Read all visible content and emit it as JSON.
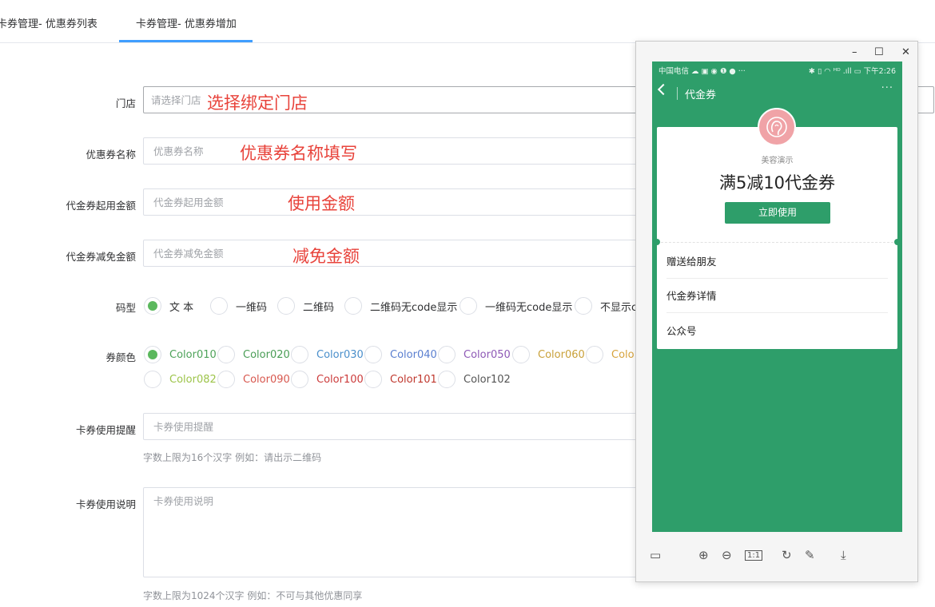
{
  "tabs": [
    {
      "label": "卡券管理- 优惠券列表",
      "active": false
    },
    {
      "label": "卡券管理- 优惠券增加",
      "active": true
    }
  ],
  "accent_color": "#409eff",
  "form": {
    "store": {
      "label": "门店",
      "placeholder": "请选择门店",
      "annotation": "选择绑定门店"
    },
    "coupon_name": {
      "label": "优惠券名称",
      "placeholder": "优惠券名称",
      "annotation": "优惠券名称填写"
    },
    "min_amount": {
      "label": "代金券起用金额",
      "placeholder": "代金券起用金额",
      "annotation": "使用金额"
    },
    "reduce_amount": {
      "label": "代金券减免金额",
      "placeholder": "代金券减免金额",
      "annotation": "减免金额"
    },
    "code_type": {
      "label": "码型",
      "options": [
        "文 本",
        "一维码",
        "二维码",
        "二维码无code显示",
        "一维码无code显示",
        "不显示c"
      ],
      "selected": 0
    },
    "color": {
      "label": "券颜色",
      "options": [
        {
          "name": "Color010",
          "hex": "#4ea35a"
        },
        {
          "name": "Color020",
          "hex": "#4a9d56"
        },
        {
          "name": "Color030",
          "hex": "#4a8fcb"
        },
        {
          "name": "Color040",
          "hex": "#5a7fd0"
        },
        {
          "name": "Color050",
          "hex": "#8e59b6"
        },
        {
          "name": "Color060",
          "hex": "#c9a13a"
        },
        {
          "name": "Colo",
          "hex": "#d7a33b"
        },
        {
          "name": "Color082",
          "hex": "#9dc44a"
        },
        {
          "name": "Color090",
          "hex": "#d8584f"
        },
        {
          "name": "Color100",
          "hex": "#cc3c3c"
        },
        {
          "name": "Color101",
          "hex": "#c0392f"
        },
        {
          "name": "Color102",
          "hex": "#555555"
        }
      ],
      "selected": 0
    },
    "reminder": {
      "label": "卡券使用提醒",
      "placeholder": "卡券使用提醒",
      "hint": "字数上限为16个汉字 例如：请出示二维码"
    },
    "description": {
      "label": "卡券使用说明",
      "placeholder": "卡券使用说明",
      "hint": "字数上限为1024个汉字 例如：不可与其他优惠同享"
    }
  },
  "preview": {
    "window_buttons": {
      "minimize": "–",
      "maximize": "☐",
      "close": "✕"
    },
    "status_left": "中国电信 ☁ ▣ ◉ ❶ ● ···",
    "status_right": "✱ ▯ ◠ ᴴᴰ .ıll ▭ 下午2:26",
    "nav_title": "代金券",
    "nav_more": "···",
    "brand": "美容演示",
    "coupon_title": "满5减10代金券",
    "use_button": "立即使用",
    "list_items": [
      "赠送给朋友",
      "代金券详情",
      "公众号"
    ],
    "screen_color": "#2e9e6a",
    "avatar_color": "#f0a3a7"
  }
}
